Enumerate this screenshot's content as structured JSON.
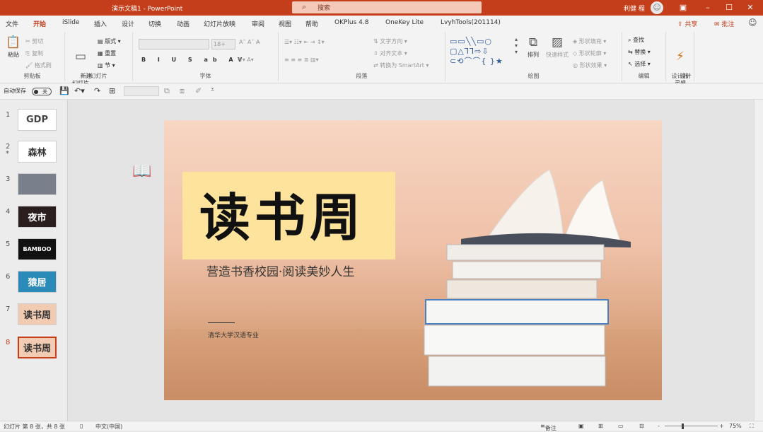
{
  "window": {
    "doc_title": "演示文稿1 - PowerPoint",
    "search_placeholder": "搜索",
    "user": "利健 程",
    "restore": "▢",
    "min": "–",
    "max": "☐",
    "close": "✕",
    "ribbon_toggle": "▣"
  },
  "tabs": [
    "文件",
    "开始",
    "iSlide",
    "插入",
    "设计",
    "切换",
    "动画",
    "幻灯片放映",
    "审阅",
    "视图",
    "帮助",
    "OKPlus 4.8",
    "OneKey Lite",
    "LvyhTools(201114)"
  ],
  "active_tab": "开始",
  "share": "共享",
  "comment": "批注",
  "ribbon": {
    "clipboard": {
      "label": "剪贴板",
      "paste": "粘贴",
      "cut": "剪切",
      "copy": "复制",
      "painter": "格式刷"
    },
    "slides": {
      "label": "幻灯片",
      "new_slide": "新建\n幻灯片",
      "layout": "版式",
      "reset": "重置",
      "section": "节"
    },
    "font": {
      "label": "字体",
      "size": "18+"
    },
    "paragraph": {
      "label": "段落",
      "text_direction": "文字方向",
      "align_text": "对齐文本",
      "smartart": "转换为 SmartArt"
    },
    "drawing": {
      "label": "绘图",
      "arrange": "排列",
      "quick_styles": "快速样式",
      "shape_fill": "形状填充",
      "shape_outline": "形状轮廓",
      "shape_effects": "形状效果"
    },
    "editing": {
      "label": "编辑",
      "find": "查找",
      "replace": "替换",
      "select": "选择"
    },
    "designer": {
      "label": "设计器",
      "design_ideas": "设计\n灵感"
    }
  },
  "qat": {
    "autosave": "自动保存",
    "toggle": "关"
  },
  "thumbnails": [
    {
      "num": "1",
      "text": "GDP",
      "bg": "#ffffff",
      "fg": "#444444"
    },
    {
      "num": "2",
      "text": "森林",
      "bg": "#ffffff",
      "fg": "#333333",
      "star": "*"
    },
    {
      "num": "3",
      "text": "",
      "bg": "#7a7f8c",
      "fg": "#ffffff"
    },
    {
      "num": "4",
      "text": "夜市",
      "bg": "#2b1e1e",
      "fg": "#ffffff"
    },
    {
      "num": "5",
      "text": "BAMBOO",
      "bg": "#111111",
      "fg": "#ffffff"
    },
    {
      "num": "6",
      "text": "猿居",
      "bg": "#2a8bb8",
      "fg": "#ffffff"
    },
    {
      "num": "7",
      "text": "读书周",
      "bg": "#f2cbb3",
      "fg": "#333333"
    },
    {
      "num": "8",
      "text": "读书周",
      "bg": "#f2cbb3",
      "fg": "#333333",
      "selected": true
    }
  ],
  "slide": {
    "title": "读书周",
    "subtitle": "营造书香校园·阅读美妙人生",
    "org": "清华大学汉语专业"
  },
  "status": {
    "slide_info": "幻灯片 第 8 张，共 8 张",
    "lang": "中文(中国)",
    "notes": "备注",
    "zoom": "75%",
    "minus": "-",
    "plus": "+"
  },
  "colors": {
    "accent": "#c43e1c",
    "title_bg": "#fde39b"
  }
}
